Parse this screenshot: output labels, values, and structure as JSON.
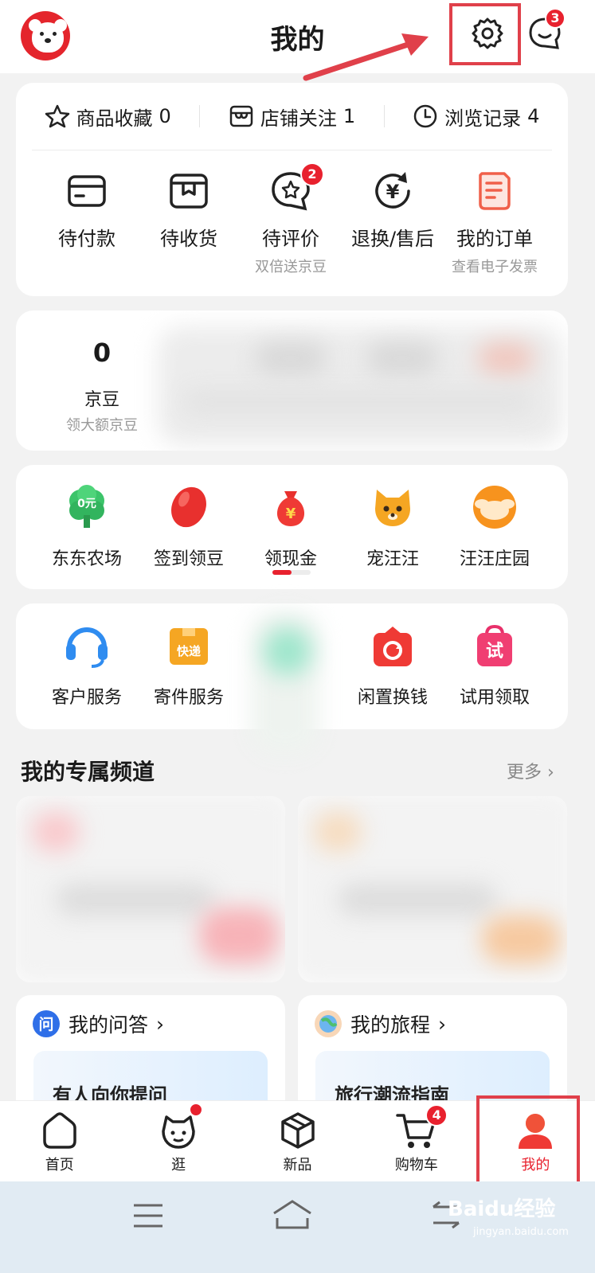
{
  "header": {
    "title": "我的",
    "message_badge": "3"
  },
  "quick_links": [
    {
      "label": "商品收藏",
      "count": "0",
      "icon": "star-icon"
    },
    {
      "label": "店铺关注",
      "count": "1",
      "icon": "shop-icon"
    },
    {
      "label": "浏览记录",
      "count": "4",
      "icon": "clock-icon"
    }
  ],
  "orders": [
    {
      "label": "待付款",
      "sub": "",
      "icon": "wallet-icon"
    },
    {
      "label": "待收货",
      "sub": "",
      "icon": "package-icon"
    },
    {
      "label": "待评价",
      "sub": "双倍送京豆",
      "icon": "review-icon",
      "badge": "2"
    },
    {
      "label": "退换/售后",
      "sub": "",
      "icon": "refund-icon"
    },
    {
      "label": "我的订单",
      "sub": "查看电子发票",
      "icon": "receipt-icon"
    }
  ],
  "beans": {
    "value": "0",
    "label": "京豆",
    "sub": "领大额京豆"
  },
  "games": [
    {
      "label": "东东农场",
      "icon": "farm-tree-icon",
      "icon_text": "0元"
    },
    {
      "label": "签到领豆",
      "icon": "red-bean-icon"
    },
    {
      "label": "领现金",
      "icon": "money-bag-icon",
      "icon_text": "¥"
    },
    {
      "label": "宠汪汪",
      "icon": "dog-icon"
    },
    {
      "label": "汪汪庄园",
      "icon": "orange-dog-icon"
    }
  ],
  "services": [
    {
      "label": "客户服务",
      "icon": "headset-icon"
    },
    {
      "label": "寄件服务",
      "icon": "express-box-icon",
      "icon_text": "快递"
    },
    {
      "label": "",
      "icon": "blurred-icon"
    },
    {
      "label": "闲置换钱",
      "icon": "recycle-bag-icon"
    },
    {
      "label": "试用领取",
      "icon": "trial-bag-icon",
      "icon_text": "试"
    }
  ],
  "channel": {
    "title": "我的专属频道",
    "more": "更多"
  },
  "qa": {
    "icon_text": "问",
    "title": "我的问答",
    "inner": "有人向你提问"
  },
  "trip": {
    "title": "我的旅程",
    "inner": "旅行潮流指南"
  },
  "tabbar": [
    {
      "label": "首页",
      "icon": "home-icon"
    },
    {
      "label": "逛",
      "icon": "face-icon",
      "dot": true
    },
    {
      "label": "新品",
      "icon": "cube-icon"
    },
    {
      "label": "购物车",
      "icon": "cart-icon",
      "badge": "4"
    },
    {
      "label": "我的",
      "icon": "me-icon",
      "active": true
    }
  ],
  "watermark": {
    "brand": "Baidu经验",
    "url": "jingyan.baidu.com"
  },
  "colors": {
    "brand_red": "#e8212e",
    "annotation_red": "#e0404a"
  }
}
